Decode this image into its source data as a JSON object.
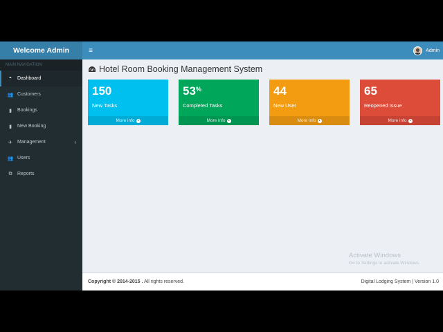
{
  "header": {
    "logo": "Welcome Admin",
    "toggle_icon": "≡",
    "user_name": "Admin"
  },
  "sidebar": {
    "section_header": "MAIN NAVIGATION",
    "items": [
      {
        "label": "Dashboard",
        "icon": "dashboard-icon",
        "glyph": "◓",
        "active": true
      },
      {
        "label": "Customers",
        "icon": "users-icon",
        "glyph": "👥"
      },
      {
        "label": "Bookings",
        "icon": "book-icon",
        "glyph": "▮"
      },
      {
        "label": "New Booking",
        "icon": "book-icon",
        "glyph": "▮"
      },
      {
        "label": "Management",
        "icon": "plane-icon",
        "glyph": "✈",
        "caret": "‹"
      },
      {
        "label": "Users",
        "icon": "users-icon",
        "glyph": "👥"
      },
      {
        "label": "Reports",
        "icon": "copy-icon",
        "glyph": "⧉"
      }
    ]
  },
  "main": {
    "title": "Hotel Room Booking Management System",
    "boxes": [
      {
        "value": "150",
        "suffix": "",
        "label": "New Tasks",
        "more": "More info",
        "color": "#00c0ef"
      },
      {
        "value": "53",
        "suffix": "%",
        "label": "Completed Tasks",
        "more": "More info",
        "color": "#00a65a"
      },
      {
        "value": "44",
        "suffix": "",
        "label": "New User",
        "more": "More info",
        "color": "#f39c12"
      },
      {
        "value": "65",
        "suffix": "",
        "label": "Reopened Issue",
        "more": "More info",
        "color": "#dd4b39"
      }
    ]
  },
  "watermark": {
    "line1": "Activate Windows",
    "line2": "Go to Settings to activate Windows."
  },
  "footer": {
    "copyright": "Copyright © 2014-2015 .",
    "rights": " All rights reserved.",
    "version": "Digital Lodging System | Version 1.0"
  }
}
